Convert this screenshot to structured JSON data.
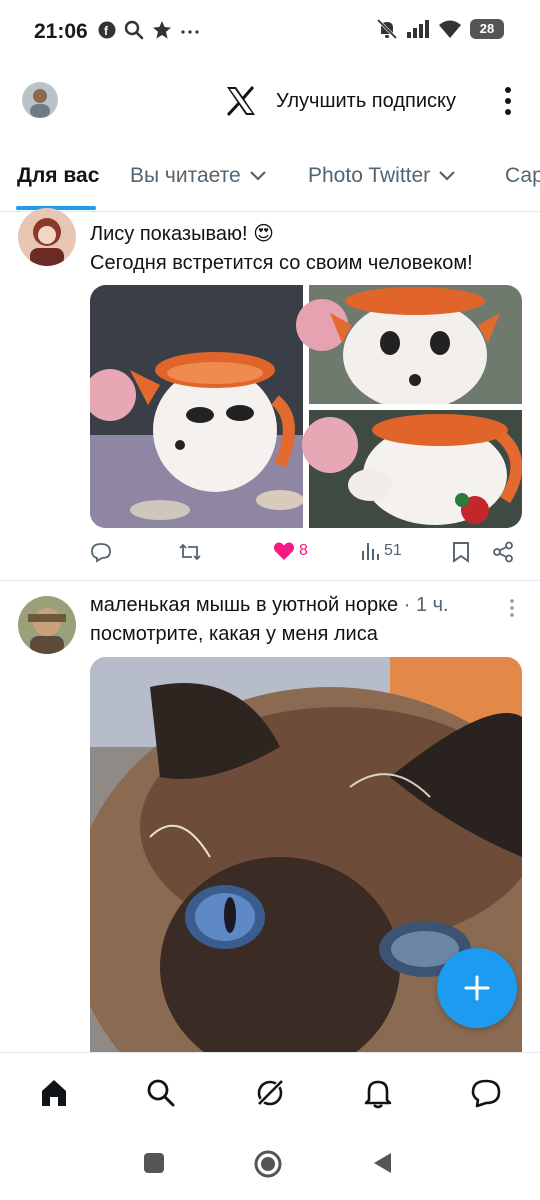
{
  "status_bar": {
    "time": "21:06",
    "battery": "28",
    "left_icons": [
      "facebook-icon",
      "search-icon",
      "star-icon",
      "more-icon"
    ],
    "right_icons": [
      "mute-icon",
      "signal-icon",
      "wifi-icon",
      "battery-icon"
    ]
  },
  "header": {
    "upgrade_label": "Улучшить подписку"
  },
  "tabs": [
    {
      "label": "Для вас",
      "active": true
    },
    {
      "label": "Вы читаете",
      "dropdown": true
    },
    {
      "label": "Photo Twitter",
      "dropdown": true
    },
    {
      "label": "Сар"
    }
  ],
  "posts": [
    {
      "text_line1": "Лису показываю! 😍",
      "text_line2": "Сегодня встретится со своим человеком!",
      "actions": {
        "replies": "",
        "reposts": "",
        "likes": "8",
        "views": "51"
      }
    },
    {
      "author": "маленькая мышь в уютной норке",
      "time": " · 1 ч.",
      "text": "посмотрите, какая у меня лиса"
    }
  ],
  "colors": {
    "accent": "#1d9bf0",
    "like": "#f91880",
    "text_primary": "#0f1419",
    "text_secondary": "#536471"
  }
}
